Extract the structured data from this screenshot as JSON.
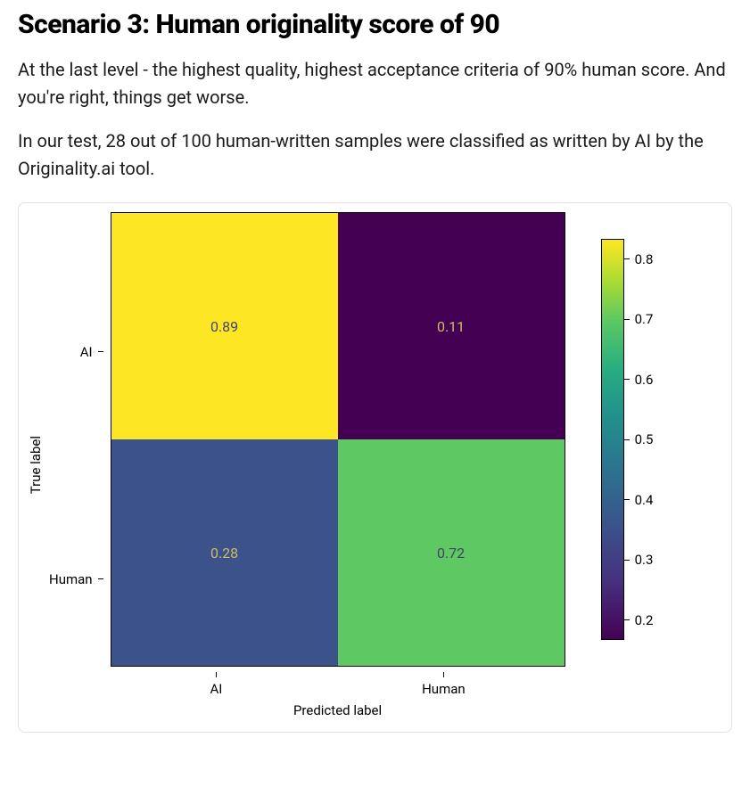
{
  "heading": "Scenario 3: Human originality score of 90",
  "para1": "At the last level - the highest quality, highest acceptance criteria of 90% human score. And you're right, things get worse.",
  "para2": "In our test, 28 out of 100 human-written samples were classified as written by AI by the Originality.ai tool.",
  "chart_data": {
    "type": "heatmap",
    "title": "",
    "xlabel": "Predicted label",
    "ylabel": "True label",
    "x_categories": [
      "AI",
      "Human"
    ],
    "y_categories": [
      "AI",
      "Human"
    ],
    "values": [
      [
        0.89,
        0.11
      ],
      [
        0.28,
        0.72
      ]
    ],
    "colorbar_ticks": [
      "0.8",
      "0.7",
      "0.6",
      "0.5",
      "0.4",
      "0.3",
      "0.2"
    ],
    "colorbar_range": [
      0.11,
      0.89
    ]
  },
  "cells": {
    "r0c0": "0.89",
    "r0c1": "0.11",
    "r1c0": "0.28",
    "r1c1": "0.72"
  }
}
